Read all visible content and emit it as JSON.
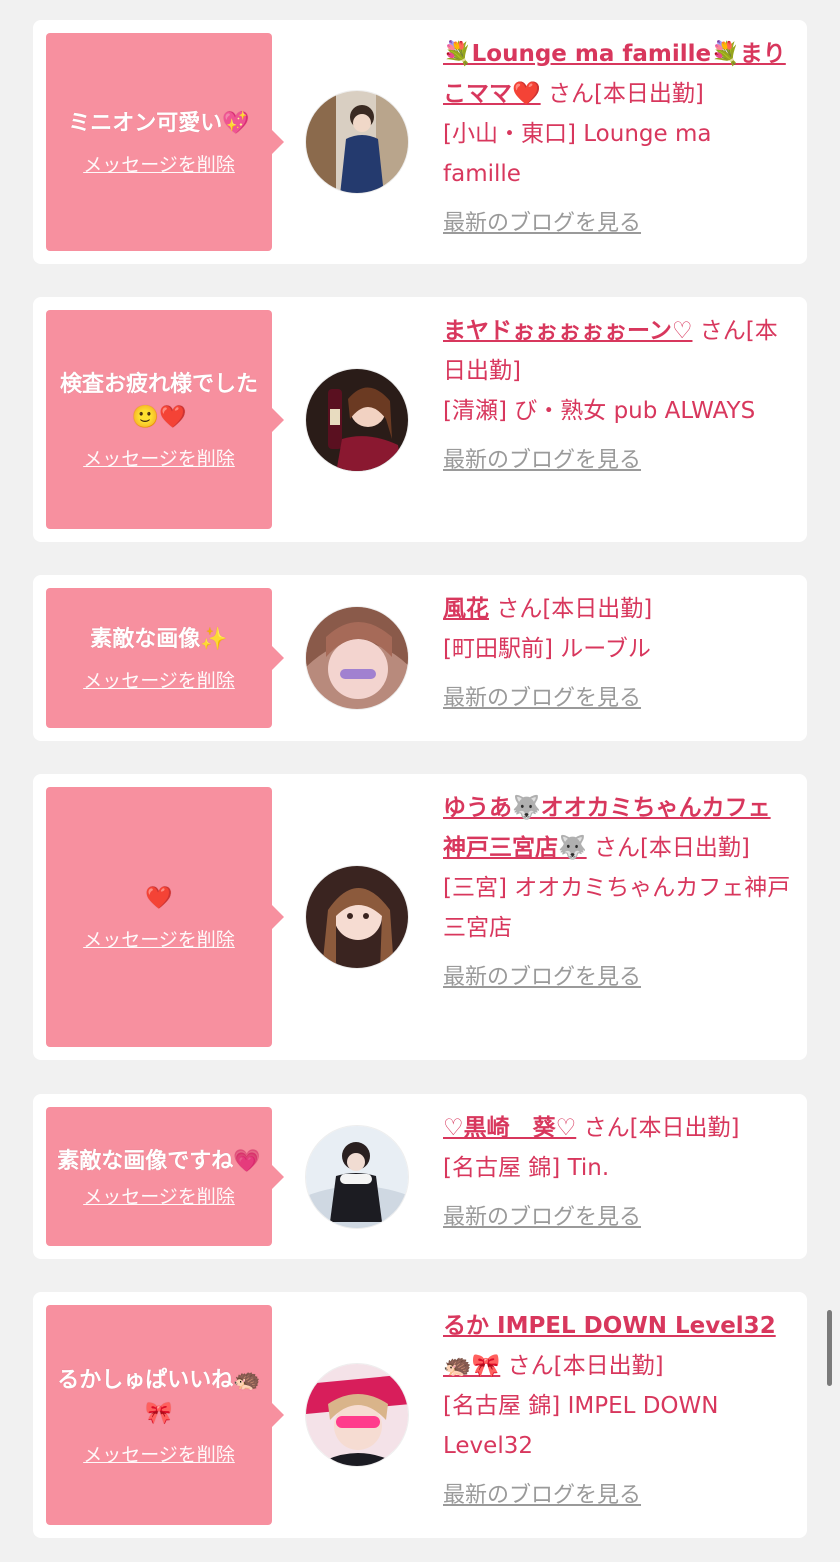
{
  "delete_label": "メッセージを削除",
  "blog_label": "最新のブログを見る",
  "cards": [
    {
      "message": "ミニオン可愛い💖",
      "name": "💐Lounge ma famille💐まりこママ❤️",
      "san": "さん[本日出勤]",
      "shop": "[小山・東口] Lounge ma famille"
    },
    {
      "message": "検査お疲れ様でした🙂❤️",
      "name": "まヤドぉぉぉぉぉーン♡",
      "san": "さん[本日出勤]",
      "shop": "[清瀬] び・熟女 pub ALWAYS"
    },
    {
      "message": "素敵な画像✨",
      "name": "風花",
      "san": "さん[本日出勤]",
      "shop": "[町田駅前] ルーブル"
    },
    {
      "message": "❤️",
      "name": "ゆうあ🐺オオカミちゃんカフェ神戸三宮店🐺",
      "san": "さん[本日出勤]",
      "shop": "[三宮] オオカミちゃんカフェ神戸三宮店"
    },
    {
      "message": "素敵な画像ですね💗",
      "name": "♡黒崎　葵♡",
      "san": "さん[本日出勤]",
      "shop": "[名古屋 錦] Tin."
    },
    {
      "message": "るかしゅぱいいね🦔🎀",
      "name": "るか IMPEL DOWN Level32🦔🎀",
      "san": "さん[本日出勤]",
      "shop": "[名古屋 錦] IMPEL DOWN Level32"
    }
  ],
  "colors": {
    "accent": "#d8375d",
    "bubble": "#f7909f",
    "background": "#f1f1f1"
  }
}
